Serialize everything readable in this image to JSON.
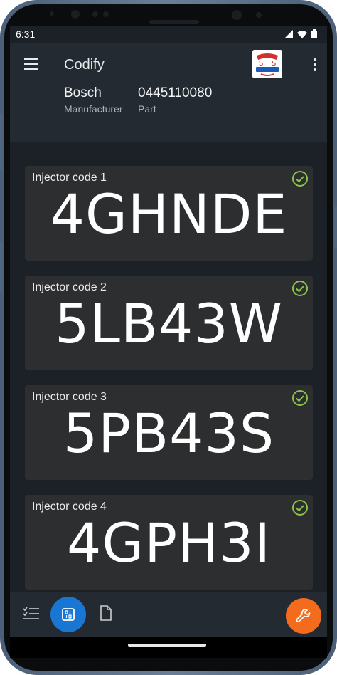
{
  "status_bar": {
    "time": "6:31"
  },
  "app_bar": {
    "title": "Codify",
    "manufacturer": {
      "value": "Bosch",
      "label": "Manufacturer"
    },
    "part": {
      "value": "0445110080",
      "label": "Part"
    }
  },
  "injectors": [
    {
      "label": "Injector code 1",
      "code": "4GHNDE",
      "verified": true
    },
    {
      "label": "Injector code 2",
      "code": "5LB43W",
      "verified": true
    },
    {
      "label": "Injector code 3",
      "code": "5PB43S",
      "verified": true
    },
    {
      "label": "Injector code 4",
      "code": "4GPH3I",
      "verified": true
    }
  ],
  "colors": {
    "background": "#1b2127",
    "app_bar": "#232a31",
    "card": "#2d2e2f",
    "check": "#8bc34a",
    "primary_fab": "#1976d2",
    "accent_fab": "#f36b1c"
  },
  "icons": {
    "menu": "menu-icon",
    "more": "more-vert-icon",
    "check": "check-circle-icon",
    "checklist": "checklist-icon",
    "codes": "chip-icon",
    "document": "document-icon",
    "wrench": "wrench-icon"
  }
}
